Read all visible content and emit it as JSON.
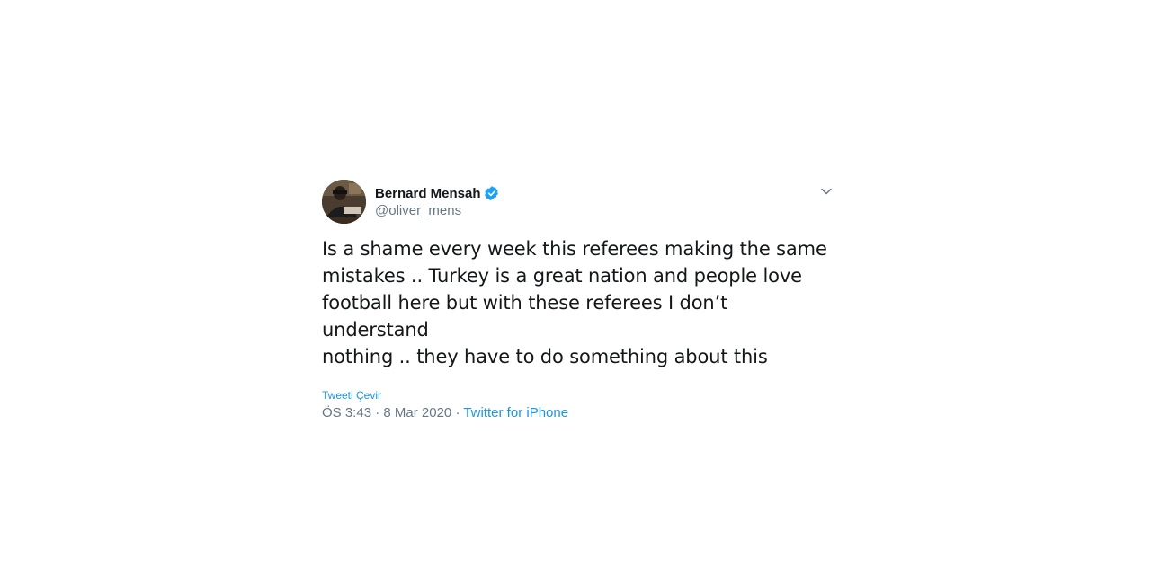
{
  "author": {
    "display_name": "Bernard Mensah",
    "handle": "@oliver_mens",
    "verified": true
  },
  "tweet": {
    "text": "Is a shame every week this referees making the same\nmistakes .. Turkey is a great nation and people love\nfootball here but with these referees I don’t understand\nnothing .. they have to do something about this",
    "translate_label": "Tweeti Çevir",
    "time": "ÖS 3:43",
    "separator1": " · ",
    "date": "8 Mar 2020",
    "separator2": " · ",
    "source": "Twitter for iPhone"
  },
  "icons": {
    "verified": "verified-badge-icon",
    "caret": "chevron-down-icon"
  },
  "colors": {
    "link": "#1b95e0",
    "verified": "#1da1f2",
    "text": "#14171a",
    "secondary": "#657786"
  }
}
